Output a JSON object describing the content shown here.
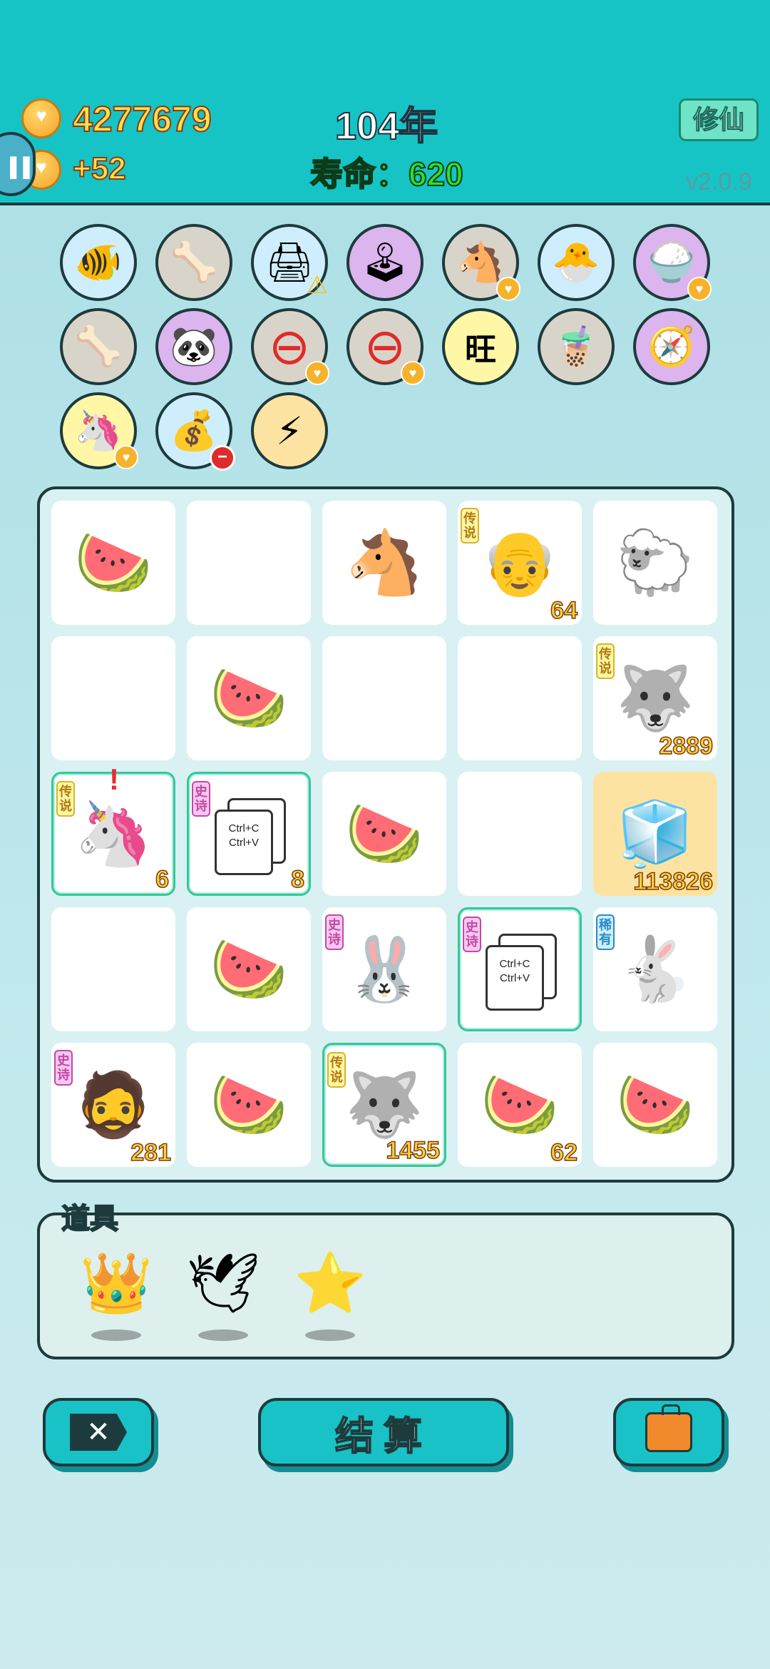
{
  "header": {
    "coins": "4277679",
    "coin_rate": "+52",
    "year": "104年",
    "life_label": "寿命：620",
    "xiuxian_button": "修仙",
    "version": "v2.0.9"
  },
  "icons": [
    {
      "name": "fish-bowl-icon",
      "glyph": "🐠",
      "bg": "#cfeefd"
    },
    {
      "name": "pet-bowl-icon",
      "glyph": "🦴",
      "bg": "#d9d4c9"
    },
    {
      "name": "printer-icon",
      "glyph": "🖨",
      "bg": "#cfeefd",
      "badge": "warn"
    },
    {
      "name": "arcade-icon",
      "glyph": "🕹",
      "bg": "#dcb4ee"
    },
    {
      "name": "twin-horse-icon",
      "glyph": "🐴",
      "bg": "#d9d4c9",
      "badge": "heart"
    },
    {
      "name": "chick-egg-icon",
      "glyph": "🐣",
      "bg": "#cfeefd"
    },
    {
      "name": "rice-bowl-icon",
      "glyph": "🍚",
      "bg": "#dcb4ee",
      "badge": "heart"
    },
    {
      "name": "pet-bowl-icon-2",
      "glyph": "🦴",
      "bg": "#d9d4c9"
    },
    {
      "name": "panda-icon",
      "glyph": "🐼",
      "bg": "#dcb4ee"
    },
    {
      "name": "no-entry-icon",
      "glyph": "⊖",
      "bg": "#d9d4c9",
      "badge": "heart"
    },
    {
      "name": "no-entry-icon-2",
      "glyph": "⊖",
      "bg": "#d9d4c9",
      "badge": "heart"
    },
    {
      "name": "wang-char-icon",
      "glyph": "旺",
      "bg": "#fff7a6"
    },
    {
      "name": "bubble-tea-icon",
      "glyph": "🧋",
      "bg": "#d9d4c9"
    },
    {
      "name": "compass-icon",
      "glyph": "🧭",
      "bg": "#dcb4ee"
    },
    {
      "name": "unicorn-icon",
      "glyph": "🦄",
      "bg": "#fff7a6",
      "badge": "heart"
    },
    {
      "name": "money-bag-icon",
      "glyph": "💰",
      "bg": "#cfeefd",
      "badge": "no"
    },
    {
      "name": "lightning-icon",
      "glyph": "⚡",
      "bg": "#fde3a2"
    }
  ],
  "tags": {
    "legend": "传说",
    "epic": "史诗",
    "rare": "稀有"
  },
  "board": [
    [
      {
        "glyph": "🍉"
      },
      {
        "glyph": ""
      },
      {
        "glyph": "🐴"
      },
      {
        "glyph": "👴",
        "tag": "legend",
        "num": "64"
      },
      {
        "glyph": "🐑"
      }
    ],
    [
      {
        "glyph": ""
      },
      {
        "glyph": "🍉"
      },
      {
        "glyph": ""
      },
      {
        "glyph": ""
      },
      {
        "glyph": "🐺",
        "tag": "legend",
        "num": "2889"
      }
    ],
    [
      {
        "glyph": "🦄",
        "tag": "legend",
        "num": "6",
        "hl": true,
        "excl": "!"
      },
      {
        "glyph": "ctrl",
        "tag": "epic",
        "num": "8",
        "hl": true
      },
      {
        "glyph": "🍉"
      },
      {
        "glyph": ""
      },
      {
        "glyph": "🧊",
        "num": "113826",
        "gold": true
      }
    ],
    [
      {
        "glyph": ""
      },
      {
        "glyph": "🍉"
      },
      {
        "glyph": "🐰",
        "tag": "epic"
      },
      {
        "glyph": "ctrl",
        "tag": "epic",
        "hl": true
      },
      {
        "glyph": "🐇",
        "tag": "rare"
      }
    ],
    [
      {
        "glyph": "🧔",
        "tag": "epic",
        "num": "281"
      },
      {
        "glyph": "🍉"
      },
      {
        "glyph": "🐺",
        "tag": "legend",
        "num": "1455",
        "hl": true
      },
      {
        "glyph": "🍉",
        "num": "62"
      },
      {
        "glyph": "🍉"
      }
    ]
  ],
  "ctrl_text": {
    "line1": "Ctrl+C",
    "line2": "Ctrl+V"
  },
  "items": {
    "title": "道具",
    "list": [
      {
        "name": "crown-icon",
        "glyph": "👑"
      },
      {
        "name": "pigeon-icon",
        "glyph": "🕊"
      },
      {
        "name": "star-icon",
        "glyph": "⭐"
      }
    ]
  },
  "buttons": {
    "close": "✕",
    "settle": "结算"
  }
}
